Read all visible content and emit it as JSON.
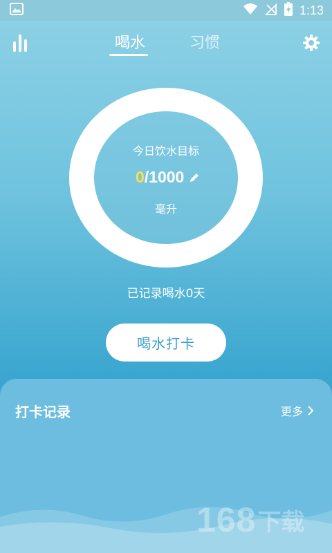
{
  "status_bar": {
    "time": "1:13",
    "icons": [
      "image-icon",
      "wifi-icon",
      "no-signal-icon",
      "battery-charging-icon"
    ]
  },
  "nav": {
    "tabs": [
      {
        "label": "喝水",
        "active": true
      },
      {
        "label": "习惯",
        "active": false
      }
    ],
    "left_icon": "bar-chart-icon",
    "right_icon": "gear-icon"
  },
  "goal": {
    "label": "今日饮水目标",
    "current": "0",
    "target": "/1000",
    "unit": "毫升",
    "edit_icon": "pencil-icon"
  },
  "recorded_days": "已记录喝水0天",
  "checkin_button": "喝水打卡",
  "records": {
    "title": "打卡记录",
    "more_label": "更多",
    "more_icon": "chevron-right-icon"
  },
  "watermark": {
    "digits": "168",
    "text": "下载"
  },
  "colors": {
    "accent_yellow": "#fbe04a",
    "button_text": "#3b9fc9",
    "panel": "#6cbde0"
  }
}
